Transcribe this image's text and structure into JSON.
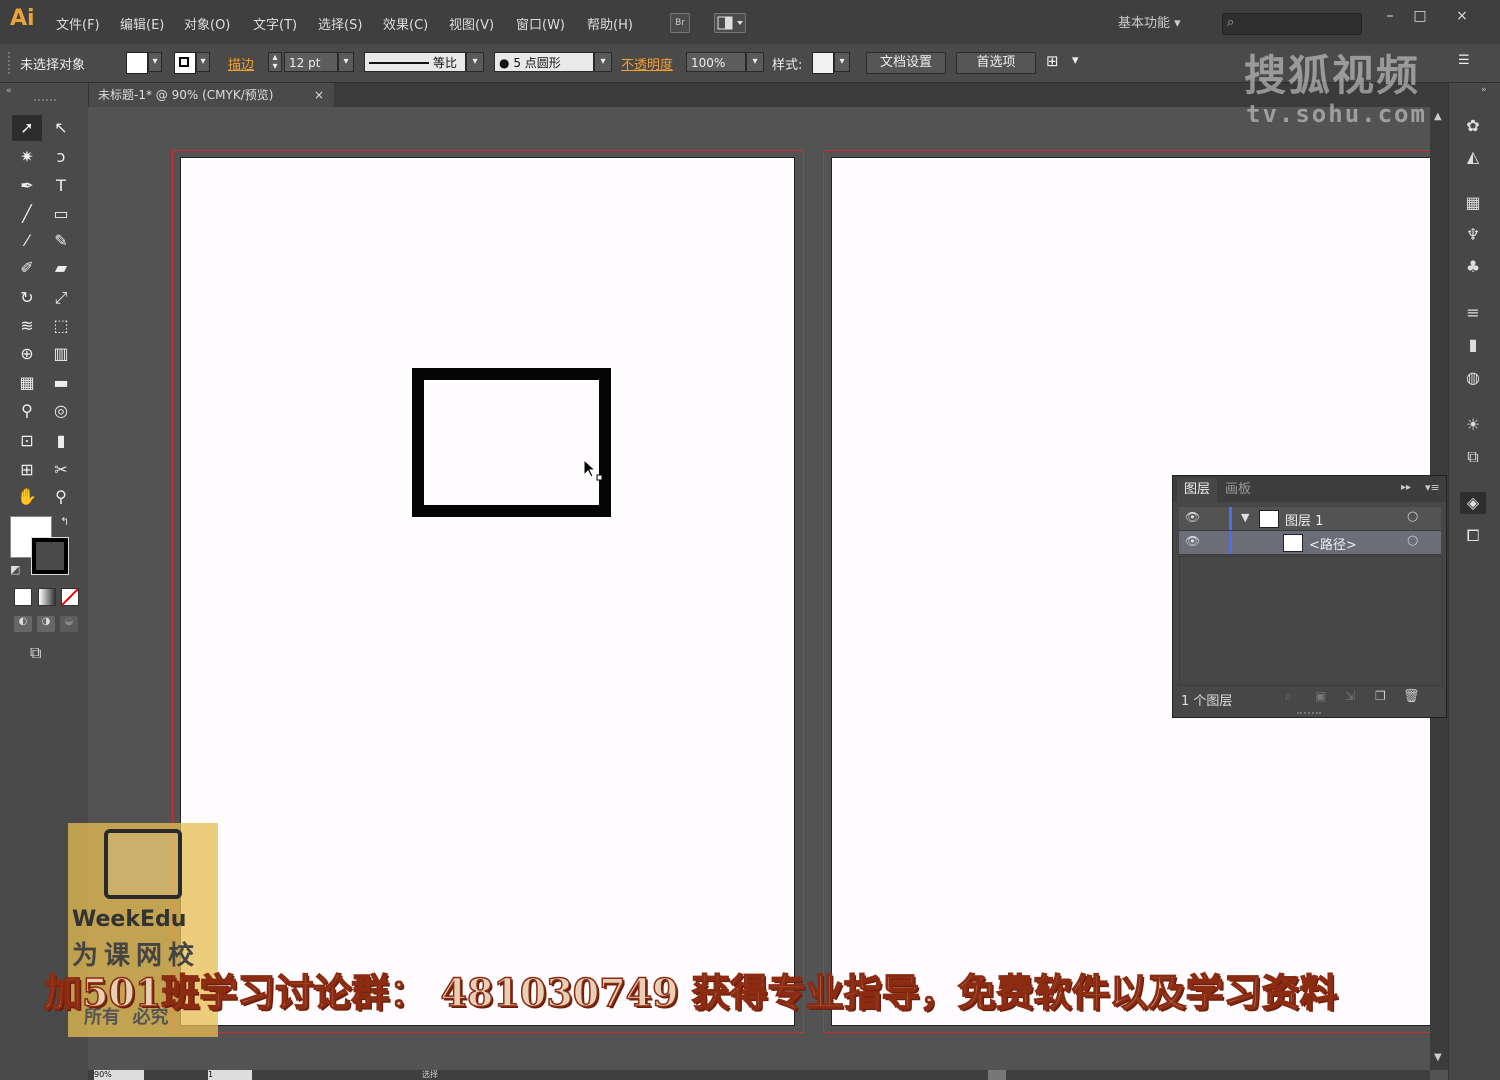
{
  "app": {
    "logo": "Ai",
    "menus": [
      "文件(F)",
      "编辑(E)",
      "对象(O)",
      "文字(T)",
      "选择(S)",
      "效果(C)",
      "视图(V)",
      "窗口(W)",
      "帮助(H)"
    ],
    "bridge_label": "Br",
    "workspace": "基本功能",
    "window_buttons": [
      "–",
      "□",
      "×"
    ]
  },
  "controlbar": {
    "selection_status": "未选择对象",
    "stroke_label": "描边",
    "stroke_weight": "12 pt",
    "stroke_profile": "等比",
    "brush": "5 点圆形",
    "opacity_label": "不透明度",
    "opacity_value": "100%",
    "style_label": "样式:",
    "doc_setup_btn": "文档设置",
    "prefs_btn": "首选项"
  },
  "document": {
    "tab_title": "未标题-1* @ 90% (CMYK/预览)",
    "tab_close": "×"
  },
  "layers_panel": {
    "tabs": [
      "图层",
      "画板"
    ],
    "rows": [
      {
        "name": "图层 1"
      },
      {
        "name": "<路径>"
      }
    ],
    "footer": "1 个图层"
  },
  "status": {
    "zoom": "90%",
    "page": "1",
    "mode": "选择"
  },
  "watermarks": {
    "sohu": "搜狐视频",
    "sohu_url": "tv.sohu.com",
    "weekedu": "WeekEdu",
    "weekedu_cn": "为课网校",
    "rights": "所有  必究"
  },
  "banner": "加501班学习讨论群：   481030749  获得专业指导，免费软件以及学习资料",
  "colors": {
    "accent": "#e8a33a",
    "bleed": "#d12b2b",
    "artboard": "#fefcfe",
    "layer_color": "#4a6cf7"
  }
}
